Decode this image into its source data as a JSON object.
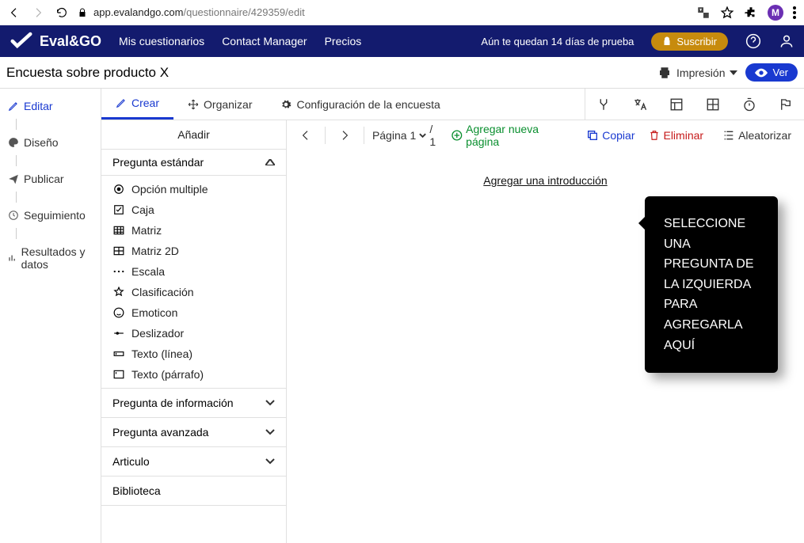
{
  "browser": {
    "host": "app.evalandgo.com",
    "path": "/questionnaire/429359/edit",
    "avatar_initial": "M"
  },
  "topnav": {
    "brand": "Eval&GO",
    "links": {
      "surveys": "Mis cuestionarios",
      "contact": "Contact Manager",
      "pricing": "Precios"
    },
    "trial_msg": "Aún te quedan 14 días de prueba",
    "subscribe": "Suscribir"
  },
  "titlebar": {
    "title": "Encuesta sobre producto X",
    "print": "Impresión",
    "view": "Ver"
  },
  "leftnav": {
    "edit": "Editar",
    "design": "Diseño",
    "publish": "Publicar",
    "tracking": "Seguimiento",
    "results": "Resultados y datos"
  },
  "tabs": {
    "create": "Crear",
    "organize": "Organizar",
    "settings": "Configuración de la encuesta"
  },
  "add_panel": {
    "heading": "Añadir",
    "std_question": "Pregunta estándar",
    "items": {
      "multiple": "Opción multiple",
      "box": "Caja",
      "matrix": "Matriz",
      "matrix2d": "Matriz 2D",
      "scale": "Escala",
      "ranking": "Clasificación",
      "emoticon": "Emoticon",
      "slider": "Deslizador",
      "textline": "Texto (línea)",
      "textpara": "Texto (párrafo)"
    },
    "info_question": "Pregunta de información",
    "adv_question": "Pregunta avanzada",
    "article": "Articulo",
    "library": "Biblioteca"
  },
  "canvas_toolbar": {
    "page_label": "Página",
    "page_current": "1",
    "page_total": "/ 1",
    "add_page": "Agregar nueva página",
    "copy": "Copiar",
    "delete": "Eliminar",
    "randomize": "Aleatorizar"
  },
  "canvas": {
    "intro_link": "Agregar una introducción",
    "tooltip": "SELECCIONE UNA PREGUNTA DE LA IZQUIERDA PARA AGREGARLA AQUÍ"
  }
}
